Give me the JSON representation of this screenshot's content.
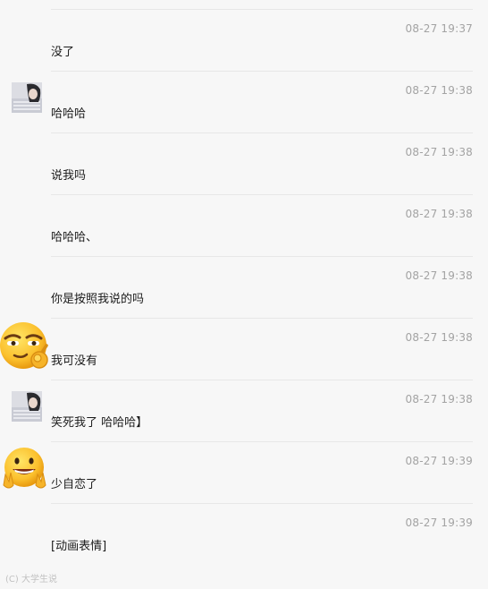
{
  "messages": [
    {
      "time": "08-27 19:37",
      "text": "没了",
      "sender": "none"
    },
    {
      "time": "08-27 19:38",
      "text": "哈哈哈",
      "sender": "photo"
    },
    {
      "time": "08-27 19:38",
      "text": "说我吗",
      "sender": "none"
    },
    {
      "time": "08-27 19:38",
      "text": "哈哈哈、",
      "sender": "none"
    },
    {
      "time": "08-27 19:38",
      "text": "你是按照我说的吗",
      "sender": "none"
    },
    {
      "time": "08-27 19:38",
      "text": "我可没有",
      "sender": "smirk-emoji"
    },
    {
      "time": "08-27 19:38",
      "text": "笑死我了 哈哈哈】",
      "sender": "photo"
    },
    {
      "time": "08-27 19:39",
      "text": "少自恋了",
      "sender": "grin-emoji"
    },
    {
      "time": "08-27 19:39",
      "text": "[动画表情]",
      "sender": "none"
    }
  ],
  "watermark": "(C) 大学生说"
}
